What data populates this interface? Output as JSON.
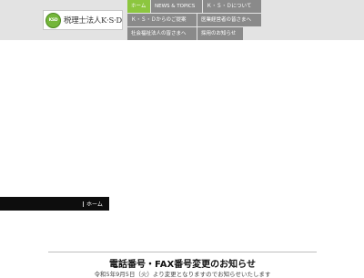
{
  "header": {
    "logo_mark_text": "KSD",
    "logo_text": "税理士法人K·S·D",
    "colors": {
      "background": "#e3e3e3",
      "nav_active": "#8cc63f",
      "nav_default": "#8a8a8a"
    }
  },
  "nav": {
    "items": [
      {
        "label": "ホーム",
        "active": true
      },
      {
        "label": "NEWS & TOPICS"
      },
      {
        "label": "Ｋ・Ｓ・Ｄについて"
      },
      {
        "label": "Ｋ・Ｓ・Ｄからのご提案"
      },
      {
        "label": "医業経営者の皆さまへ"
      },
      {
        "label": "社会福祉法人の皆さまへ"
      },
      {
        "label": "採用のお知らせ"
      }
    ]
  },
  "breadcrumb": {
    "label": "ホーム"
  },
  "news": {
    "title": "電話番号・FAX番号変更のお知らせ",
    "subtitle": "令和5年9月5日（火）より変更となりますのでお知らせいたします"
  }
}
